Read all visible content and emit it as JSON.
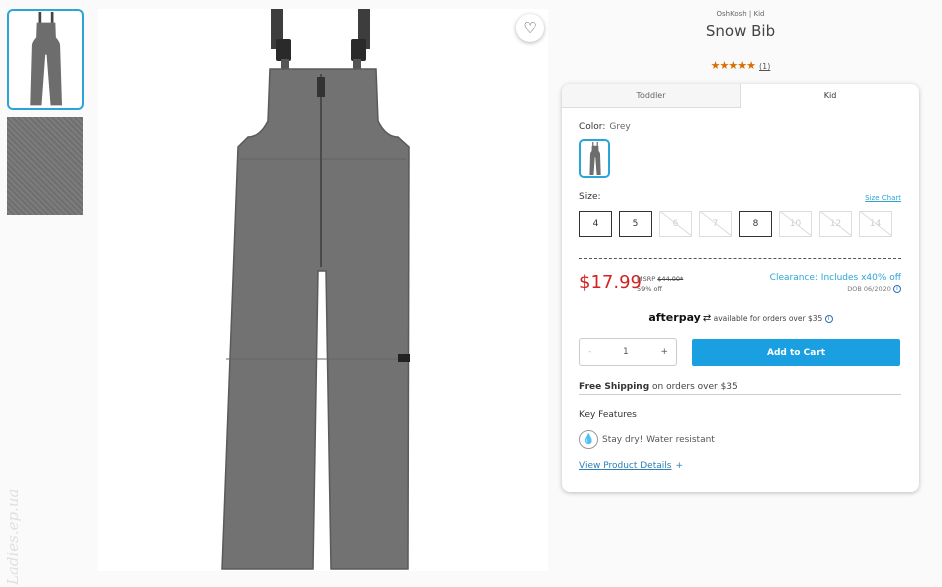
{
  "product": {
    "brand": "OshKosh | Kid",
    "title": "Snow Bib",
    "stars": "★★★★★",
    "review_count": "(1)",
    "rating": 5
  },
  "tabs": [
    "Toddler",
    "Kid"
  ],
  "active_tab": "Kid",
  "color": {
    "label": "Color:",
    "value": "Grey"
  },
  "size": {
    "label": "Size:",
    "chart_link": "Size Chart",
    "options": [
      {
        "label": "4",
        "available": true
      },
      {
        "label": "5",
        "available": true
      },
      {
        "label": "6",
        "available": false
      },
      {
        "label": "7",
        "available": false
      },
      {
        "label": "8",
        "available": true
      },
      {
        "label": "10",
        "available": false
      },
      {
        "label": "12",
        "available": false
      },
      {
        "label": "14",
        "available": false
      }
    ]
  },
  "pricing": {
    "price": "$17.99",
    "msrp_label": "MSRP",
    "msrp_value": "$44.00*",
    "discount": "59% off",
    "clearance": "Clearance: Includes x40% off",
    "dob": "DOB 06/2020"
  },
  "afterpay": {
    "brand": "afterpay",
    "text": "available for orders over $35"
  },
  "quantity": {
    "minus": "-",
    "value": "1",
    "plus": "+"
  },
  "cart_button": "Add to Cart",
  "shipping": {
    "bold": "Free Shipping",
    "rest": "on orders over $35"
  },
  "key_features": {
    "title": "Key Features",
    "items": [
      "Stay dry! Water resistant"
    ]
  },
  "details_link": "View Product Details",
  "details_plus": "+",
  "watermark": "Ladies.ep.ua",
  "colors": {
    "accent": "#2ba5d6",
    "cart": "#1aa0e0",
    "price": "#d6211f",
    "stars": "#d96e00"
  }
}
